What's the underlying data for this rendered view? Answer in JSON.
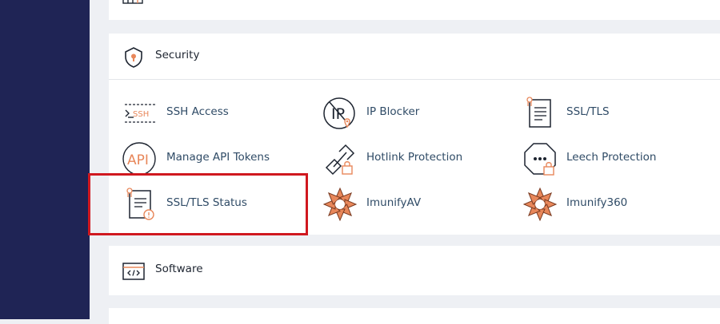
{
  "security": {
    "title": "Security",
    "items": [
      {
        "label": "SSH Access",
        "icon": "ssh-icon"
      },
      {
        "label": "IP Blocker",
        "icon": "ip-blocker-icon"
      },
      {
        "label": "SSL/TLS",
        "icon": "certificate-icon"
      },
      {
        "label": "Manage API Tokens",
        "icon": "api-icon"
      },
      {
        "label": "Hotlink Protection",
        "icon": "hotlink-icon"
      },
      {
        "label": "Leech Protection",
        "icon": "leech-icon"
      },
      {
        "label": "SSL/TLS Status",
        "icon": "certificate-status-icon"
      },
      {
        "label": "ImunifyAV",
        "icon": "imunify-icon"
      },
      {
        "label": "Imunify360",
        "icon": "imunify-icon"
      }
    ],
    "ssh_icon_text": "SSH",
    "api_icon_text": "API",
    "ip_icon_text": "IP"
  },
  "software": {
    "title": "Software"
  },
  "colors": {
    "sidebar": "#1f2455",
    "accent": "#e8875a",
    "link": "#2f4b66",
    "highlight": "#d0181f"
  }
}
